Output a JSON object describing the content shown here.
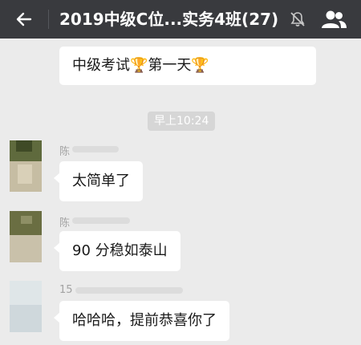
{
  "header": {
    "title": "2019中级C位...实务4班(27)",
    "back_icon": "back-arrow-icon",
    "mute_icon": "bell-muted-icon",
    "members_icon": "group-members-icon"
  },
  "messages": [
    {
      "type": "text",
      "side": "left",
      "text": "中级考试🏆第一天🏆"
    },
    {
      "type": "time",
      "text": "早上10:24"
    },
    {
      "type": "text",
      "side": "left",
      "sender": "陈",
      "text": "太简单了"
    },
    {
      "type": "text",
      "side": "left",
      "sender": "陈",
      "text": "90 分稳如泰山"
    },
    {
      "type": "text",
      "side": "left",
      "sender": "15",
      "text": "哈哈哈，提前恭喜你了"
    }
  ],
  "colors": {
    "titlebar": "#393a3e",
    "background": "#ebebeb",
    "bubble": "#ffffff",
    "timestamp_bg": "#d6d6d6"
  }
}
